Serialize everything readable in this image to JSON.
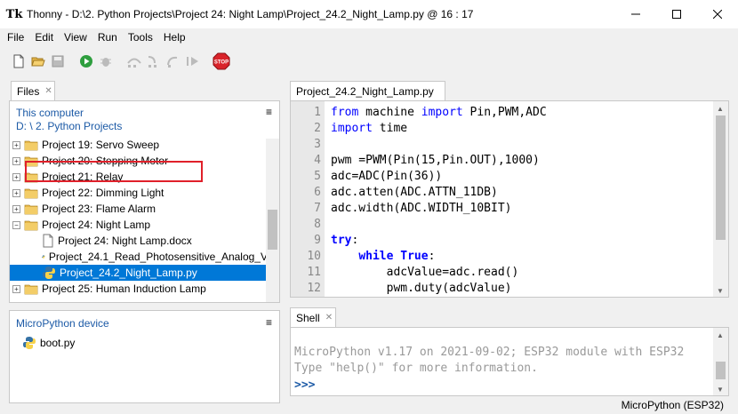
{
  "window": {
    "title": "Thonny  -  D:\\2. Python Projects\\Project 24:  Night Lamp\\Project_24.2_Night_Lamp.py  @  16 : 17",
    "app_icon": "Tk"
  },
  "menu": [
    "File",
    "Edit",
    "View",
    "Run",
    "Tools",
    "Help"
  ],
  "files_panel": {
    "tab_label": "Files",
    "location_label": "This computer",
    "path_label": "D: \\ 2. Python Projects",
    "items": [
      {
        "label": "Project 19:  Servo Sweep",
        "type": "folder",
        "expanded": false
      },
      {
        "label": "Project 20:  Stepping Motor",
        "type": "folder",
        "expanded": false
      },
      {
        "label": "Project 21:  Relay",
        "type": "folder",
        "expanded": false
      },
      {
        "label": "Project 22:  Dimming Light",
        "type": "folder",
        "expanded": false
      },
      {
        "label": "Project 23:  Flame Alarm",
        "type": "folder",
        "expanded": false
      },
      {
        "label": "Project 24:  Night Lamp",
        "type": "folder",
        "expanded": true
      },
      {
        "label": "Project 24:  Night Lamp.docx",
        "type": "file",
        "indent": 1
      },
      {
        "label": "Project_24.1_Read_Photosensitive_Analog_V",
        "type": "py",
        "indent": 1
      },
      {
        "label": "Project_24.2_Night_Lamp.py",
        "type": "py",
        "indent": 1,
        "selected": true
      },
      {
        "label": "Project 25:  Human  Induction Lamp",
        "type": "folder",
        "expanded": false
      }
    ]
  },
  "device_panel": {
    "title": "MicroPython device",
    "items": [
      {
        "label": "boot.py"
      }
    ]
  },
  "editor": {
    "tab_label": "Project_24.2_Night_Lamp.py",
    "line_numbers": [
      "1",
      "2",
      "3",
      "4",
      "5",
      "6",
      "7",
      "8",
      "9",
      "10",
      "11",
      "12"
    ],
    "lines": [
      [
        {
          "t": "from",
          "c": "kw"
        },
        {
          "t": " machine ",
          "c": ""
        },
        {
          "t": "import",
          "c": "kw"
        },
        {
          "t": " Pin,PWM,ADC",
          "c": ""
        }
      ],
      [
        {
          "t": "import",
          "c": "kw"
        },
        {
          "t": " time",
          "c": ""
        }
      ],
      [],
      [
        {
          "t": "pwm =PWM(Pin(15,Pin.OUT),1000)",
          "c": ""
        }
      ],
      [
        {
          "t": "adc=ADC(Pin(36))",
          "c": ""
        }
      ],
      [
        {
          "t": "adc.atten(ADC.ATTN_11DB)",
          "c": ""
        }
      ],
      [
        {
          "t": "adc.width(ADC.WIDTH_10BIT)",
          "c": ""
        }
      ],
      [],
      [
        {
          "t": "try",
          "c": "kwb"
        },
        {
          "t": ":",
          "c": ""
        }
      ],
      [
        {
          "t": "    ",
          "c": ""
        },
        {
          "t": "while",
          "c": "kwb"
        },
        {
          "t": " ",
          "c": ""
        },
        {
          "t": "True",
          "c": "kwb"
        },
        {
          "t": ":",
          "c": ""
        }
      ],
      [
        {
          "t": "        adcValue=adc.read()",
          "c": ""
        }
      ],
      [
        {
          "t": "        pwm.duty(adcValue)",
          "c": ""
        }
      ]
    ]
  },
  "shell": {
    "tab_label": "Shell",
    "lines": [
      "MicroPython v1.17 on 2021-09-02; ESP32 module with ESP32",
      "Type \"help()\" for more information."
    ],
    "prompt": ">>>"
  },
  "status": {
    "interpreter": "MicroPython (ESP32)"
  },
  "colors": {
    "selection": "#0078d7",
    "link_blue": "#1c5aa6",
    "keyword_blue": "#0000ff",
    "highlight_red": "#e0202a"
  }
}
